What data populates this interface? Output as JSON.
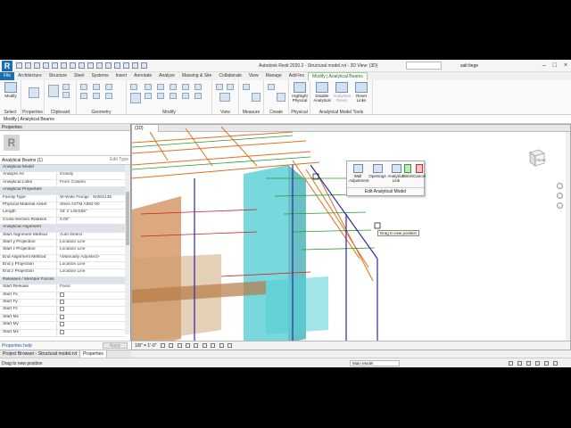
{
  "titlebar": {
    "app_logo": "R",
    "title": "Autodesk Revit 2020.2 - Structural model.rvt - 3D View: {3D}",
    "user": "salt tiege"
  },
  "tabs": [
    {
      "label": "File"
    },
    {
      "label": "Architecture"
    },
    {
      "label": "Structure"
    },
    {
      "label": "Steel"
    },
    {
      "label": "Systems"
    },
    {
      "label": "Insert"
    },
    {
      "label": "Annotate"
    },
    {
      "label": "Analyze"
    },
    {
      "label": "Massing & Site"
    },
    {
      "label": "Collaborate"
    },
    {
      "label": "View"
    },
    {
      "label": "Manage"
    },
    {
      "label": "Add-Ins"
    },
    {
      "label": "Modify | Analytical Beams"
    }
  ],
  "ribbon": {
    "modify_label": "Modify",
    "groups": {
      "select": "Select",
      "properties": "Properties",
      "clipboard": "Clipboard",
      "geometry": "Geometry",
      "modify": "Modify",
      "view": "View",
      "measure": "Measure",
      "create": "Create",
      "physical": "Physical",
      "analytical_tools": "Analytical Model Tools"
    },
    "buttons": {
      "highlight_physical": "Highlight Physical",
      "disable_analytical": "Disable Analytical",
      "analytical_reset": "Analytical Reset",
      "reset_links": "Reset Links"
    }
  },
  "context_bar": "Modify | Analytical Beams",
  "properties": {
    "title": "Properties",
    "instance": "Analytical Beams (1)",
    "edit_type": "Edit Type",
    "rows": [
      {
        "k": "Analytical Model",
        "v": "",
        "cat": true
      },
      {
        "k": "Analyze As",
        "v": "Gravity"
      },
      {
        "k": "Analytical Links",
        "v": "From Column"
      },
      {
        "k": "Analytical Properties",
        "v": "",
        "cat": true
      },
      {
        "k": "Family Type",
        "v": "W-Wide Flange : W36X135"
      },
      {
        "k": "Physical Material Asset",
        "v": "Steel ASTM A992-50"
      },
      {
        "k": "Length",
        "v": "33' 2 145/256\""
      },
      {
        "k": "Cross-Section Rotation",
        "v": "0.00°"
      },
      {
        "k": "Analytical Alignment",
        "v": "",
        "cat": true
      },
      {
        "k": "Start Alignment Method",
        "v": "Auto-Detect"
      },
      {
        "k": "Start y Projection",
        "v": "Location Line"
      },
      {
        "k": "Start z Projection",
        "v": "Location Line"
      },
      {
        "k": "End Alignment Method",
        "v": "<Manually Adjusted>"
      },
      {
        "k": "End y Projection",
        "v": "Location Line"
      },
      {
        "k": "End z Projection",
        "v": "Location Line"
      },
      {
        "k": "Releases / Member Forces",
        "v": "",
        "cat": true
      },
      {
        "k": "Start Release",
        "v": "Fixed"
      },
      {
        "k": "Start Fx",
        "v": "",
        "cb": true
      },
      {
        "k": "Start Fy",
        "v": "",
        "cb": true
      },
      {
        "k": "Start Fz",
        "v": "",
        "cb": true
      },
      {
        "k": "Start Mx",
        "v": "",
        "cb": true
      },
      {
        "k": "Start My",
        "v": "",
        "cb": true
      },
      {
        "k": "Start Mz",
        "v": "",
        "cb": true
      }
    ],
    "help_link": "Properties help",
    "apply": "Apply"
  },
  "view": {
    "tab": "{3D}",
    "popup": {
      "wall_adjustment": "Wall Adjustment",
      "openings": "Openings",
      "analytical_link": "Analytical Link",
      "finish": "Finish",
      "cancel": "Cancel",
      "group_label": "Edit Analytical Model"
    },
    "tooltip": "Drag to new position",
    "viewcube_label": "FRONT",
    "scale": "1/8\" = 1'-0\""
  },
  "bottom_tabs": [
    "Project Browser - Structural model.rvt",
    "Properties"
  ],
  "status": {
    "message": "Drag to new position",
    "model": "Main Model"
  },
  "colors": {
    "accent": "#1a6fb0",
    "beam_orange": "#e07020",
    "column_cyan": "#3ec8d0",
    "analytical_blue": "#2a2aa8"
  }
}
